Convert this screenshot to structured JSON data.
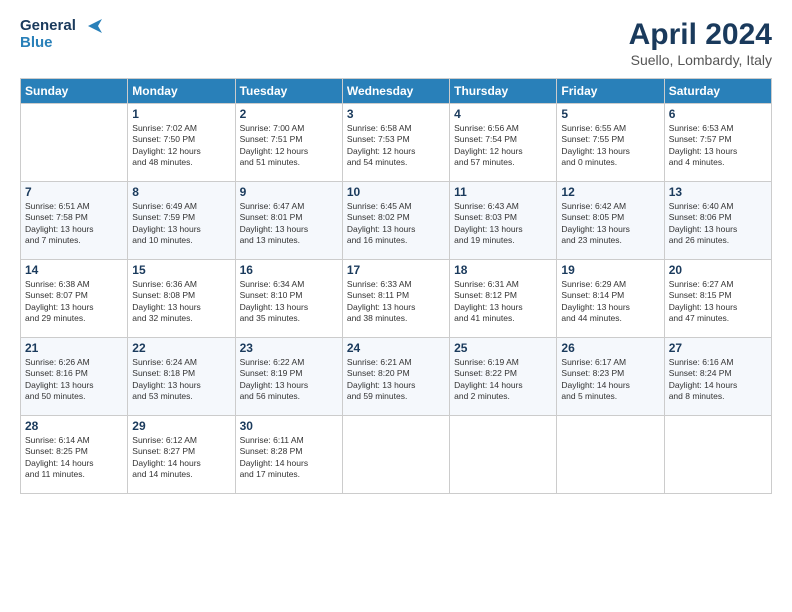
{
  "logo": {
    "line1": "General",
    "line2": "Blue"
  },
  "title": "April 2024",
  "subtitle": "Suello, Lombardy, Italy",
  "days_of_week": [
    "Sunday",
    "Monday",
    "Tuesday",
    "Wednesday",
    "Thursday",
    "Friday",
    "Saturday"
  ],
  "weeks": [
    [
      {
        "day": "",
        "info": ""
      },
      {
        "day": "1",
        "info": "Sunrise: 7:02 AM\nSunset: 7:50 PM\nDaylight: 12 hours\nand 48 minutes."
      },
      {
        "day": "2",
        "info": "Sunrise: 7:00 AM\nSunset: 7:51 PM\nDaylight: 12 hours\nand 51 minutes."
      },
      {
        "day": "3",
        "info": "Sunrise: 6:58 AM\nSunset: 7:53 PM\nDaylight: 12 hours\nand 54 minutes."
      },
      {
        "day": "4",
        "info": "Sunrise: 6:56 AM\nSunset: 7:54 PM\nDaylight: 12 hours\nand 57 minutes."
      },
      {
        "day": "5",
        "info": "Sunrise: 6:55 AM\nSunset: 7:55 PM\nDaylight: 13 hours\nand 0 minutes."
      },
      {
        "day": "6",
        "info": "Sunrise: 6:53 AM\nSunset: 7:57 PM\nDaylight: 13 hours\nand 4 minutes."
      }
    ],
    [
      {
        "day": "7",
        "info": "Sunrise: 6:51 AM\nSunset: 7:58 PM\nDaylight: 13 hours\nand 7 minutes."
      },
      {
        "day": "8",
        "info": "Sunrise: 6:49 AM\nSunset: 7:59 PM\nDaylight: 13 hours\nand 10 minutes."
      },
      {
        "day": "9",
        "info": "Sunrise: 6:47 AM\nSunset: 8:01 PM\nDaylight: 13 hours\nand 13 minutes."
      },
      {
        "day": "10",
        "info": "Sunrise: 6:45 AM\nSunset: 8:02 PM\nDaylight: 13 hours\nand 16 minutes."
      },
      {
        "day": "11",
        "info": "Sunrise: 6:43 AM\nSunset: 8:03 PM\nDaylight: 13 hours\nand 19 minutes."
      },
      {
        "day": "12",
        "info": "Sunrise: 6:42 AM\nSunset: 8:05 PM\nDaylight: 13 hours\nand 23 minutes."
      },
      {
        "day": "13",
        "info": "Sunrise: 6:40 AM\nSunset: 8:06 PM\nDaylight: 13 hours\nand 26 minutes."
      }
    ],
    [
      {
        "day": "14",
        "info": "Sunrise: 6:38 AM\nSunset: 8:07 PM\nDaylight: 13 hours\nand 29 minutes."
      },
      {
        "day": "15",
        "info": "Sunrise: 6:36 AM\nSunset: 8:08 PM\nDaylight: 13 hours\nand 32 minutes."
      },
      {
        "day": "16",
        "info": "Sunrise: 6:34 AM\nSunset: 8:10 PM\nDaylight: 13 hours\nand 35 minutes."
      },
      {
        "day": "17",
        "info": "Sunrise: 6:33 AM\nSunset: 8:11 PM\nDaylight: 13 hours\nand 38 minutes."
      },
      {
        "day": "18",
        "info": "Sunrise: 6:31 AM\nSunset: 8:12 PM\nDaylight: 13 hours\nand 41 minutes."
      },
      {
        "day": "19",
        "info": "Sunrise: 6:29 AM\nSunset: 8:14 PM\nDaylight: 13 hours\nand 44 minutes."
      },
      {
        "day": "20",
        "info": "Sunrise: 6:27 AM\nSunset: 8:15 PM\nDaylight: 13 hours\nand 47 minutes."
      }
    ],
    [
      {
        "day": "21",
        "info": "Sunrise: 6:26 AM\nSunset: 8:16 PM\nDaylight: 13 hours\nand 50 minutes."
      },
      {
        "day": "22",
        "info": "Sunrise: 6:24 AM\nSunset: 8:18 PM\nDaylight: 13 hours\nand 53 minutes."
      },
      {
        "day": "23",
        "info": "Sunrise: 6:22 AM\nSunset: 8:19 PM\nDaylight: 13 hours\nand 56 minutes."
      },
      {
        "day": "24",
        "info": "Sunrise: 6:21 AM\nSunset: 8:20 PM\nDaylight: 13 hours\nand 59 minutes."
      },
      {
        "day": "25",
        "info": "Sunrise: 6:19 AM\nSunset: 8:22 PM\nDaylight: 14 hours\nand 2 minutes."
      },
      {
        "day": "26",
        "info": "Sunrise: 6:17 AM\nSunset: 8:23 PM\nDaylight: 14 hours\nand 5 minutes."
      },
      {
        "day": "27",
        "info": "Sunrise: 6:16 AM\nSunset: 8:24 PM\nDaylight: 14 hours\nand 8 minutes."
      }
    ],
    [
      {
        "day": "28",
        "info": "Sunrise: 6:14 AM\nSunset: 8:25 PM\nDaylight: 14 hours\nand 11 minutes."
      },
      {
        "day": "29",
        "info": "Sunrise: 6:12 AM\nSunset: 8:27 PM\nDaylight: 14 hours\nand 14 minutes."
      },
      {
        "day": "30",
        "info": "Sunrise: 6:11 AM\nSunset: 8:28 PM\nDaylight: 14 hours\nand 17 minutes."
      },
      {
        "day": "",
        "info": ""
      },
      {
        "day": "",
        "info": ""
      },
      {
        "day": "",
        "info": ""
      },
      {
        "day": "",
        "info": ""
      }
    ]
  ]
}
